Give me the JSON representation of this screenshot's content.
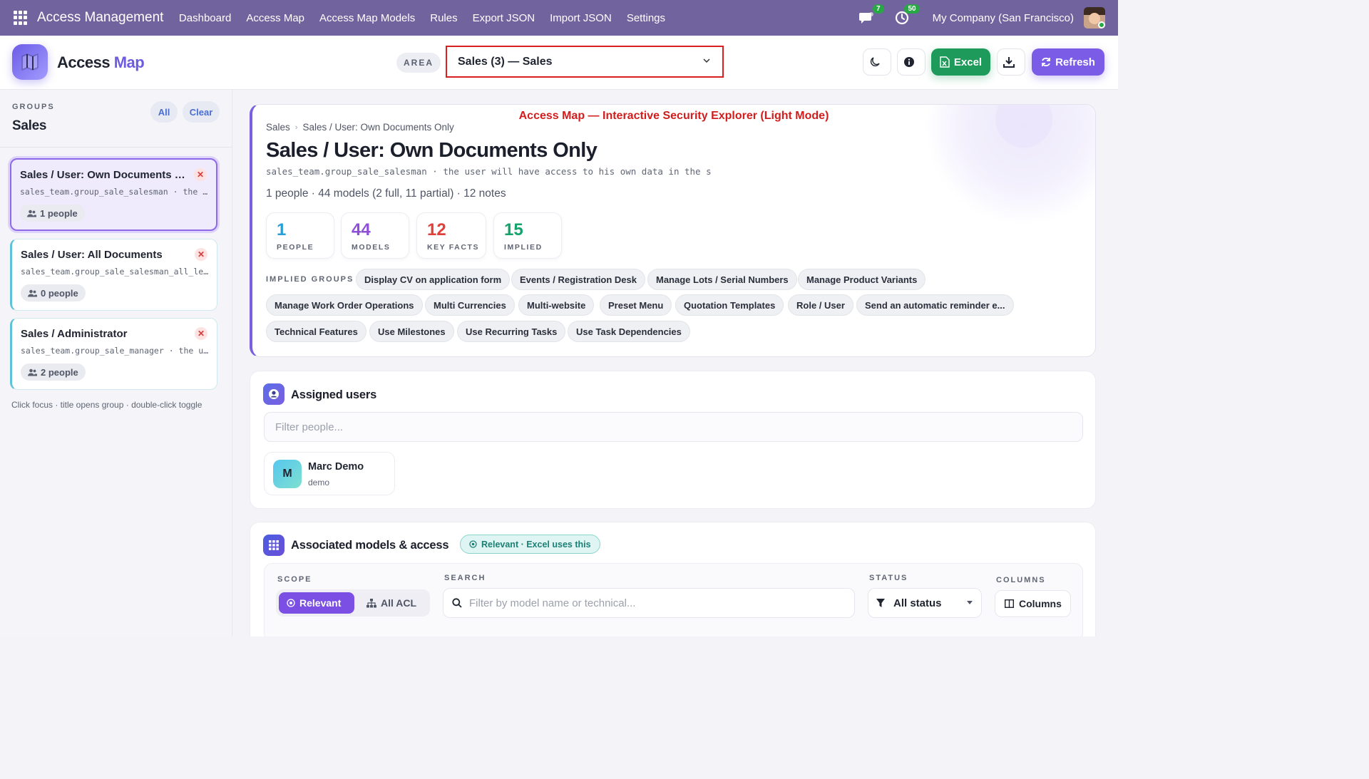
{
  "topnav": {
    "app_name": "Access Management",
    "items": [
      "Dashboard",
      "Access Map",
      "Access Map Models",
      "Rules",
      "Export JSON",
      "Import JSON",
      "Settings"
    ],
    "chat_badge": "7",
    "activity_badge": "50",
    "company": "My Company (San Francisco)"
  },
  "header": {
    "title_part1": "Access",
    "title_part2": "Map",
    "area_label": "AREA",
    "area_value": "Sales (3) — Sales",
    "excel_label": "Excel",
    "refresh_label": "Refresh"
  },
  "sidebar": {
    "groups_label": "GROUPS",
    "title": "Sales",
    "all_label": "All",
    "clear_label": "Clear",
    "cards": [
      {
        "title": "Sales / User: Own Documents Only",
        "tech": "sales_team.group_sale_salesman · the user will have access to his own data",
        "people": "1 people"
      },
      {
        "title": "Sales / User: All Documents",
        "tech": "sales_team.group_sale_salesman_all_leads",
        "people": "0 people"
      },
      {
        "title": "Sales / Administrator",
        "tech": "sales_team.group_sale_manager · the user will have an access to the sales configuration",
        "people": "2 people"
      }
    ],
    "hint": "Click focus · title opens group · double-click toggle"
  },
  "hero": {
    "annotation": "Access Map — Interactive Security Explorer (Light Mode)",
    "crumb1": "Sales",
    "crumb2": "Sales / User: Own Documents Only",
    "title": "Sales / User: Own Documents Only",
    "tech": "sales_team.group_sale_salesman · the user will have access to his own data in the s",
    "summary": "1 people · 44 models (2 full, 11 partial) · 12 notes",
    "stats": [
      {
        "value": "1",
        "label": "PEOPLE",
        "color": "#2a9fd6"
      },
      {
        "value": "44",
        "label": "MODELS",
        "color": "#8e4fd8"
      },
      {
        "value": "12",
        "label": "KEY FACTS",
        "color": "#e0403a"
      },
      {
        "value": "15",
        "label": "IMPLIED",
        "color": "#13a36b"
      }
    ],
    "implied_label": "IMPLIED GROUPS",
    "implied_groups": [
      "Display CV on application form",
      "Events / Registration Desk",
      "Manage Lots / Serial Numbers",
      "Manage Product Variants",
      "Manage Work Order Operations",
      "Multi Currencies",
      "Multi-website",
      "Preset Menu",
      "Quotation Templates",
      "Role / User",
      "Send an automatic reminder e...",
      "Technical Features",
      "Use Milestones",
      "Use Recurring Tasks",
      "Use Task Dependencies"
    ]
  },
  "users_panel": {
    "title": "Assigned users",
    "filter_placeholder": "Filter people...",
    "users": [
      {
        "initial": "M",
        "name": "Marc Demo",
        "login": "demo"
      }
    ]
  },
  "models_panel": {
    "title": "Associated models & access",
    "badge": "Relevant · Excel uses this",
    "scope_label": "SCOPE",
    "scope_on": "Relevant",
    "scope_off": "All ACL",
    "search_label": "SEARCH",
    "search_placeholder": "Filter by model name or technical...",
    "status_label": "STATUS",
    "status_value": "All status",
    "columns_label": "COLUMNS",
    "columns_button": "Columns"
  }
}
